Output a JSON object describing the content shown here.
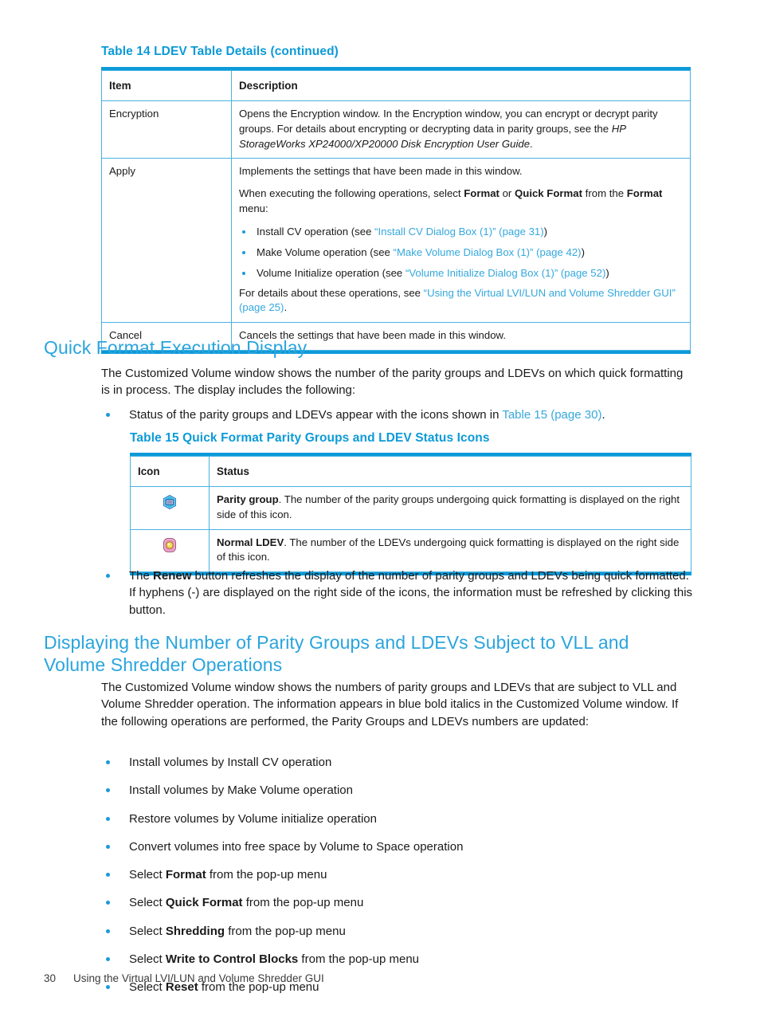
{
  "table14": {
    "caption_main": "Table 14 LDEV Table Details",
    "caption_continued": "(continued)",
    "headers": [
      "Item",
      "Description"
    ],
    "rows": [
      {
        "item": "Encryption",
        "desc_p1_a": "Opens the Encryption window. In the Encryption window, you can encrypt or decrypt parity groups. For details about encrypting or decrypting data in parity groups, see the ",
        "desc_p1_ital": "HP StorageWorks XP24000/XP20000 Disk Encryption User Guide",
        "desc_p1_b": "."
      },
      {
        "item": "Apply",
        "desc_p1": "Implements the settings that have been made in this window.",
        "desc_p2_a": "When executing the following operations, select ",
        "desc_p2_b1": "Format",
        "desc_p2_c": " or ",
        "desc_p2_b2": "Quick Format",
        "desc_p2_d": " from the ",
        "desc_p2_b3": "Format",
        "desc_p2_e": " menu:",
        "bullets": [
          {
            "pre": "Install CV operation (see ",
            "link": "“Install CV Dialog Box (1)” (page 31)",
            "post": ")"
          },
          {
            "pre": "Make Volume operation (see ",
            "link": "“Make Volume Dialog Box (1)” (page 42)",
            "post": ")"
          },
          {
            "pre": "Volume Initialize operation (see ",
            "link": "“Volume Initialize Dialog Box (1)” (page 52)",
            "post": ")"
          }
        ],
        "desc_p3_a": "For details about these operations, see ",
        "desc_p3_link": "“Using the Virtual LVI/LUN and Volume Shredder GUI” (page 25)",
        "desc_p3_b": "."
      },
      {
        "item": "Cancel",
        "desc_p1": "Cancels the settings that have been made in this window."
      }
    ]
  },
  "section_quick_format": {
    "heading": "Quick Format Execution Display",
    "paragraph": "The Customized Volume window shows the number of the parity groups and LDEVs on which quick formatting is in process. The display includes the following:",
    "bullet_pre": "Status of the parity groups and LDEVs appear with the icons shown in ",
    "bullet_link": "Table 15 (page 30)",
    "bullet_post": "."
  },
  "table15": {
    "caption_main": "Table 15 Quick Format Parity Groups and LDEV Status Icons",
    "headers": [
      "Icon",
      "Status"
    ],
    "rows": [
      {
        "icon_name": "parity-group-icon",
        "status_bold": "Parity group",
        "status_text": ". The number of the parity groups undergoing quick formatting is displayed on the right side of this icon."
      },
      {
        "icon_name": "normal-ldev-icon",
        "status_bold": "Normal LDEV",
        "status_text": ". The number of the LDEVs undergoing quick formatting is displayed on the right side of this icon."
      }
    ]
  },
  "renew_bullet": {
    "pre": "The ",
    "bold": "Renew",
    "post": " button refreshes the display of the number of parity groups and LDEVs being quick formatted. If hyphens (-) are displayed on the right side of the icons, the information must be refreshed by clicking this button."
  },
  "section_displaying": {
    "heading": "Displaying the Number of Parity Groups and LDEVs Subject to VLL and Volume Shredder Operations",
    "paragraph": "The Customized Volume window shows the numbers of parity groups and LDEVs that are subject to VLL and Volume Shredder operation. The information appears in blue bold italics in the Customized Volume window. If the following operations are performed, the Parity Groups and LDEVs numbers are updated:",
    "bullets": [
      {
        "pre": "Install volumes by Install CV operation",
        "bold": "",
        "post": ""
      },
      {
        "pre": "Install volumes by Make Volume operation",
        "bold": "",
        "post": ""
      },
      {
        "pre": "Restore volumes by Volume initialize operation",
        "bold": "",
        "post": ""
      },
      {
        "pre": "Convert volumes into free space by Volume to Space operation",
        "bold": "",
        "post": ""
      },
      {
        "pre": "Select ",
        "bold": "Format",
        "post": " from the pop-up menu"
      },
      {
        "pre": "Select ",
        "bold": "Quick Format",
        "post": " from the pop-up menu"
      },
      {
        "pre": "Select ",
        "bold": "Shredding",
        "post": " from the pop-up menu"
      },
      {
        "pre": "Select ",
        "bold": "Write to Control Blocks",
        "post": " from the pop-up menu"
      },
      {
        "pre": "Select ",
        "bold": "Reset",
        "post": " from the pop-up menu"
      }
    ]
  },
  "footer": {
    "page_number": "30",
    "chapter_title": "Using the Virtual LVI/LUN and Volume Shredder GUI"
  },
  "colors": {
    "heading_blue": "#2aa4dd",
    "caption_blue": "#0c9ad8",
    "link_blue": "#35a8dd",
    "table_border": "#49b2e0",
    "bullet_blue": "#1b9ad8",
    "body_text": "#1a1a1a"
  }
}
